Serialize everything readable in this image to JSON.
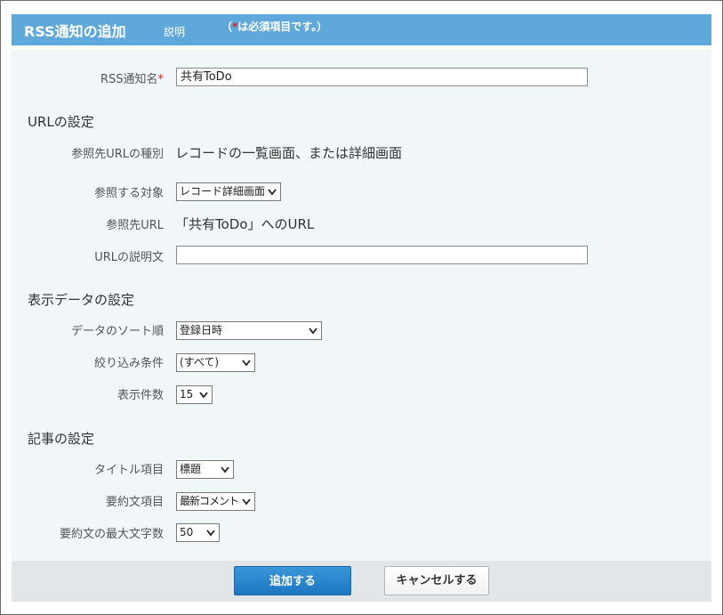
{
  "header": {
    "title": "RSS通知の追加",
    "help_link": "説明",
    "required_note_prefix": "（",
    "required_mark": "*",
    "required_note_suffix": "は必須項目です。）"
  },
  "form": {
    "rss_name": {
      "label": "RSS通知名",
      "required_mark": "*",
      "value": "共有ToDo"
    },
    "url_section": {
      "title": "URLの設定"
    },
    "url_type": {
      "label": "参照先URLの種別",
      "value": "レコードの一覧画面、または詳細画面"
    },
    "target": {
      "label": "参照する対象",
      "selected": "レコード詳細画面"
    },
    "ref_url": {
      "label": "参照先URL",
      "value": "「共有ToDo」へのURL"
    },
    "url_desc": {
      "label": "URLの説明文",
      "value": ""
    },
    "display_section": {
      "title": "表示データの設定"
    },
    "sort_order": {
      "label": "データのソート順",
      "selected": "登録日時"
    },
    "filter": {
      "label": "絞り込み条件",
      "selected": "(すべて)"
    },
    "count": {
      "label": "表示件数",
      "selected": "15"
    },
    "article_section": {
      "title": "記事の設定"
    },
    "title_item": {
      "label": "タイトル項目",
      "selected": "標題"
    },
    "summary_item": {
      "label": "要約文項目",
      "selected": "最新コメント"
    },
    "summary_max": {
      "label": "要約文の最大文字数",
      "selected": "50"
    }
  },
  "footer": {
    "add_label": "追加する",
    "cancel_label": "キャンセルする"
  },
  "colors": {
    "header_bg": "#5ea8dc",
    "content_bg": "#f1f6f9",
    "footer_bg": "#e3e6e9",
    "primary_button": "#1d77c2",
    "required_mark": "#e0202a"
  },
  "icons": {
    "select_arrow": "chevron-down-icon"
  }
}
